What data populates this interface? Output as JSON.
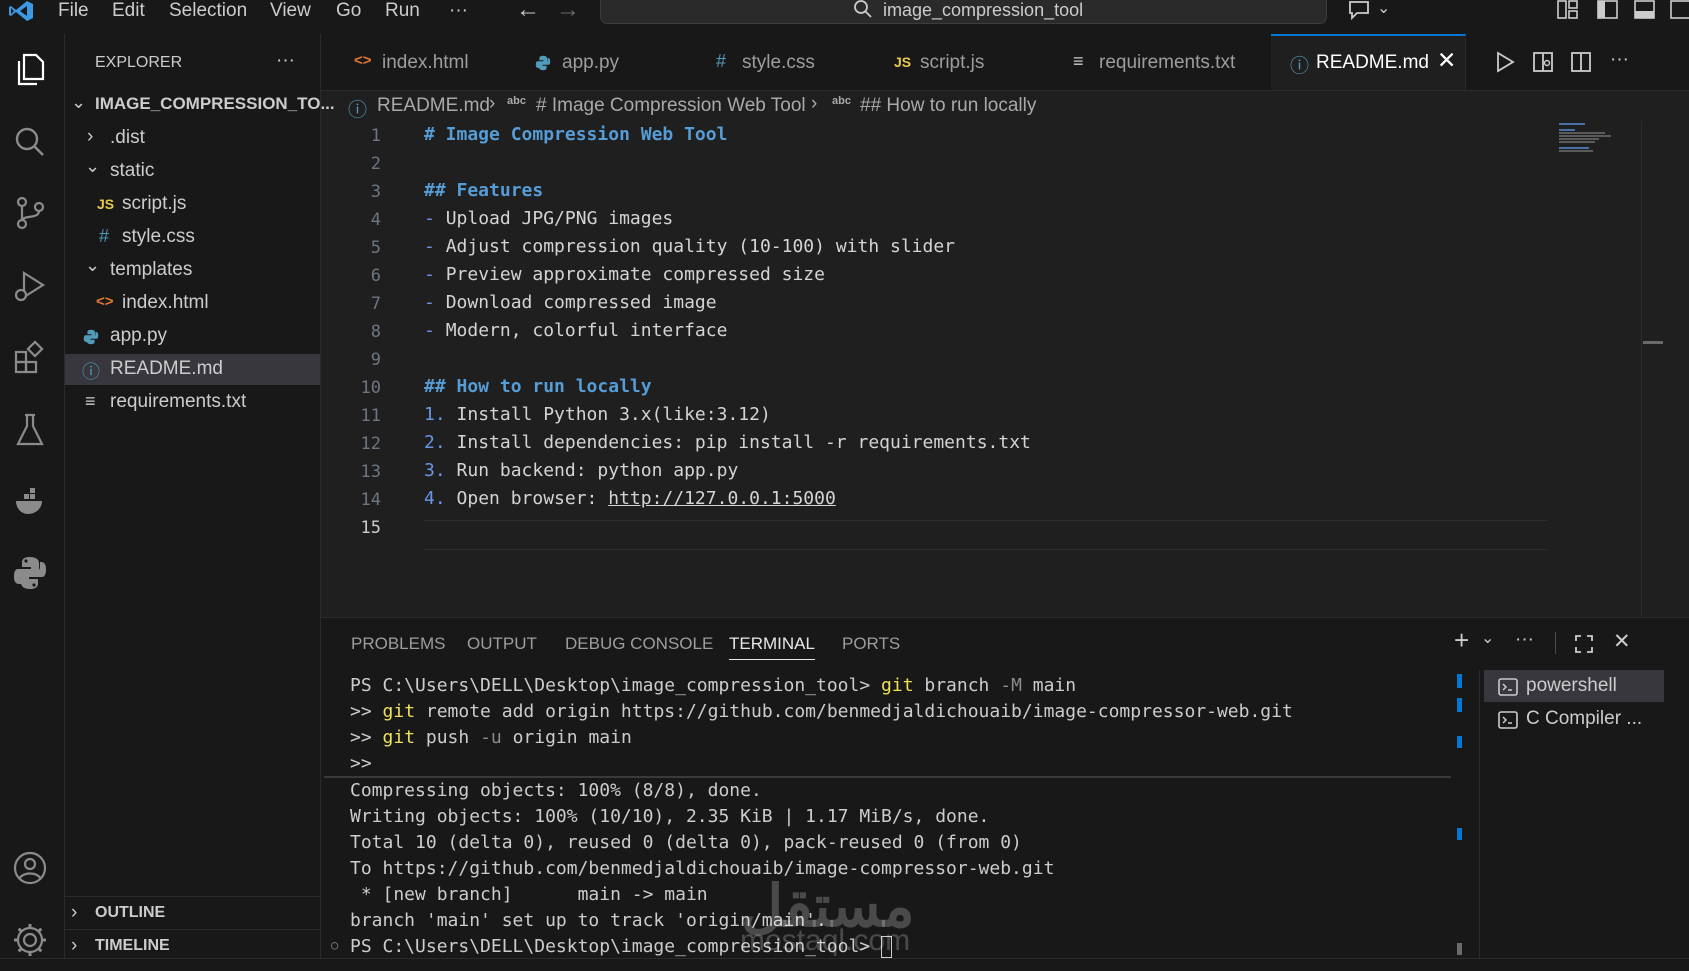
{
  "menu": [
    "File",
    "Edit",
    "Selection",
    "View",
    "Go",
    "Run",
    "···"
  ],
  "command_center": "image_compression_tool",
  "sidebar": {
    "title": "EXPLORER",
    "more": "···",
    "root": "IMAGE_COMPRESSION_TO...",
    "items": [
      {
        "label": ".dist"
      },
      {
        "label": "static"
      },
      {
        "label": "script.js",
        "icon": "JS"
      },
      {
        "label": "style.css",
        "icon": "#"
      },
      {
        "label": "templates"
      },
      {
        "label": "index.html",
        "icon": "<>"
      },
      {
        "label": "app.py"
      },
      {
        "label": "README.md"
      },
      {
        "label": "requirements.txt"
      }
    ],
    "outline": "OUTLINE",
    "timeline": "TIMELINE"
  },
  "tabs": [
    {
      "label": "index.html",
      "icon": "<>"
    },
    {
      "label": "app.py"
    },
    {
      "label": "style.css",
      "icon": "#"
    },
    {
      "label": "script.js",
      "icon": "JS"
    },
    {
      "label": "requirements.txt",
      "icon": "≡"
    },
    {
      "label": "README.md",
      "icon": "ⓘ"
    }
  ],
  "breadcrumb": {
    "file": "README.md",
    "sym_icon": "abc",
    "h1": "# Image Compression Web Tool",
    "h2": "## How to run locally"
  },
  "editor": {
    "line_numbers": [
      "1",
      "2",
      "3",
      "4",
      "5",
      "6",
      "7",
      "8",
      "9",
      "10",
      "11",
      "12",
      "13",
      "14",
      "15"
    ],
    "lines": [
      {
        "a": "",
        "b": "# Image Compression Web Tool"
      },
      {
        "a": "",
        "b": ""
      },
      {
        "a": "",
        "b": "## Features"
      },
      {
        "a": "- ",
        "b": "Upload JPG/PNG images"
      },
      {
        "a": "- ",
        "b": "Adjust compression quality (10-100) with slider"
      },
      {
        "a": "- ",
        "b": "Preview approximate compressed size"
      },
      {
        "a": "- ",
        "b": "Download compressed image"
      },
      {
        "a": "- ",
        "b": "Modern, colorful interface"
      },
      {
        "a": "",
        "b": ""
      },
      {
        "a": "",
        "b": "## How to run locally"
      },
      {
        "a": "1. ",
        "b": "Install Python 3.x(like:3.12)"
      },
      {
        "a": "2. ",
        "b": "Install dependencies: pip install -r requirements.txt"
      },
      {
        "a": "3. ",
        "b": "Run backend: python app.py"
      },
      {
        "a": "4. ",
        "b": "Open browser: "
      },
      {
        "a": "",
        "b": ""
      }
    ],
    "link": "http://127.0.0.1:5000"
  },
  "panel": {
    "tabs": [
      "PROBLEMS",
      "OUTPUT",
      "DEBUG CONSOLE",
      "TERMINAL",
      "PORTS"
    ],
    "terminal": {
      "l1_prompt": "PS C:\\Users\\DELL\\Desktop\\image_compression_tool> ",
      "l1_git": "git",
      "l1_a": " branch ",
      "l1_flag": "-M",
      "l1_b": " main",
      "l2_prompt": ">> ",
      "l2_git": "git",
      "l2_rest": " remote add origin https://github.com/benmedjaldichouaib/image-compressor-web.git",
      "l3_prompt": ">> ",
      "l3_git": "git",
      "l3_a": " push ",
      "l3_flag": "-u",
      "l3_b": " origin main",
      "l4": ">>",
      "out": [
        "Compressing objects: 100% (8/8), done.",
        "Writing objects: 100% (10/10), 2.35 KiB | 1.17 MiB/s, done.",
        "Total 10 (delta 0), reused 0 (delta 0), pack-reused 0 (from 0)",
        "To https://github.com/benmedjaldichouaib/image-compressor-web.git",
        " * [new branch]      main -> main",
        "branch 'main' set up to track 'origin/main'.",
        "PS C:\\Users\\DELL\\Desktop\\image_compression_tool> "
      ]
    },
    "terminal_list": [
      "powershell",
      "C Compiler ..."
    ]
  },
  "watermark": {
    "arabic": "مستقل",
    "latin": "mostaql.com"
  }
}
